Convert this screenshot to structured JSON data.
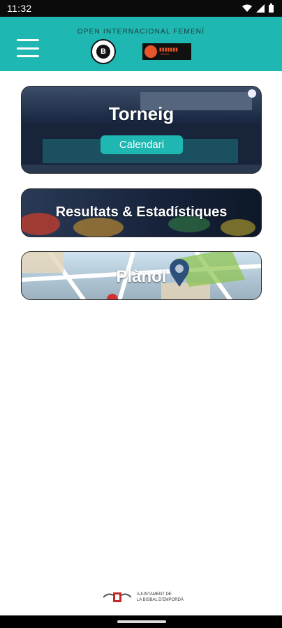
{
  "status_bar": {
    "time": "11:32",
    "icons": [
      "wifi-icon",
      "signal-icon",
      "battery-icon"
    ]
  },
  "header": {
    "subtitle": "OPEN INTERNACIONAL FEMENÍ",
    "menu_icon": "hamburger-menu-icon",
    "logos": [
      "club-logo-icon",
      "sponsor-logo-icon"
    ],
    "bg_color": "#1fb7b2"
  },
  "cards": {
    "torneig": {
      "title": "Torneig",
      "button": "Calendari"
    },
    "resultats": {
      "title": "Resultats & Estadístiques"
    },
    "planol": {
      "title": "Plànol"
    }
  },
  "footer": {
    "line1": "AJUNTAMENT DE",
    "line2": "LA BISBAL D'EMPORDÀ"
  }
}
